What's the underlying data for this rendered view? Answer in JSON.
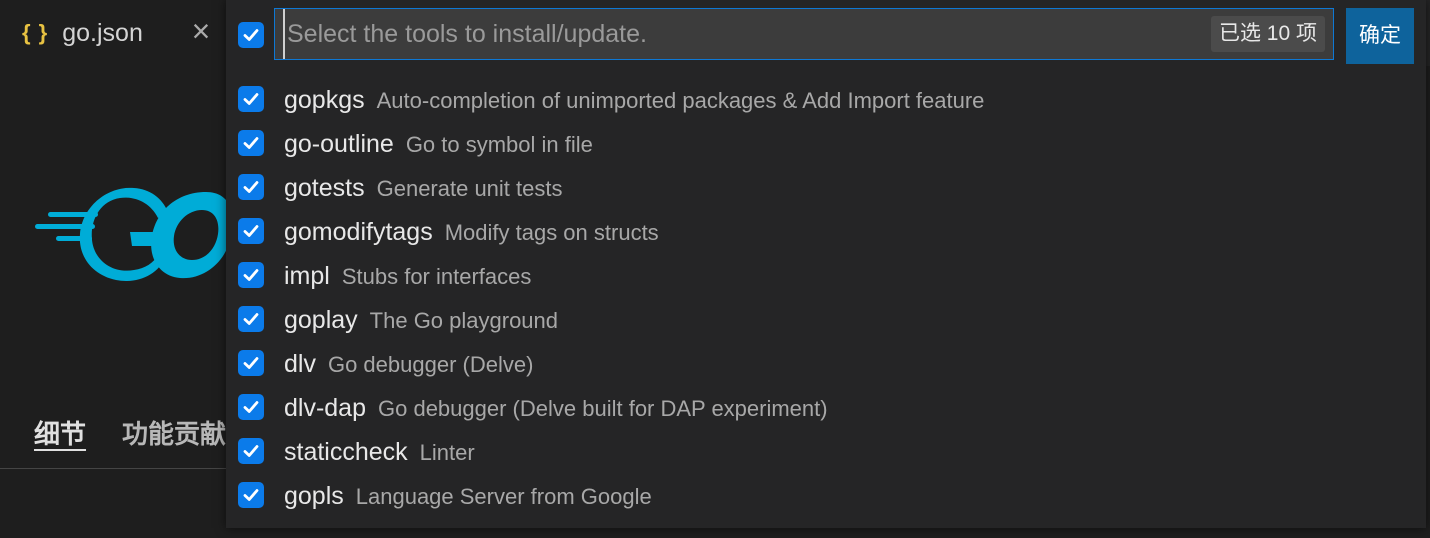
{
  "editor": {
    "tab": {
      "icon": "{ }",
      "label": "go.json",
      "close": "×"
    },
    "logo": "go-logo",
    "ext_tabs": [
      "细节",
      "功能贡献"
    ]
  },
  "quickpick": {
    "placeholder": "Select the tools to install/update.",
    "count_badge": "已选 10 项",
    "ok_label": "确定",
    "select_all_checked": true,
    "items": [
      {
        "name": "gopkgs",
        "description": "Auto-completion of unimported packages & Add Import feature",
        "checked": true
      },
      {
        "name": "go-outline",
        "description": "Go to symbol in file",
        "checked": true
      },
      {
        "name": "gotests",
        "description": "Generate unit tests",
        "checked": true
      },
      {
        "name": "gomodifytags",
        "description": "Modify tags on structs",
        "checked": true
      },
      {
        "name": "impl",
        "description": "Stubs for interfaces",
        "checked": true
      },
      {
        "name": "goplay",
        "description": "The Go playground",
        "checked": true
      },
      {
        "name": "dlv",
        "description": "Go debugger (Delve)",
        "checked": true
      },
      {
        "name": "dlv-dap",
        "description": "Go debugger (Delve built for DAP experiment)",
        "checked": true
      },
      {
        "name": "staticcheck",
        "description": "Linter",
        "checked": true
      },
      {
        "name": "gopls",
        "description": "Language Server from Google",
        "checked": true
      }
    ]
  },
  "colors": {
    "accent": "#0b7bea",
    "ok_button": "#0e639c",
    "go_blue": "#00acd7"
  }
}
